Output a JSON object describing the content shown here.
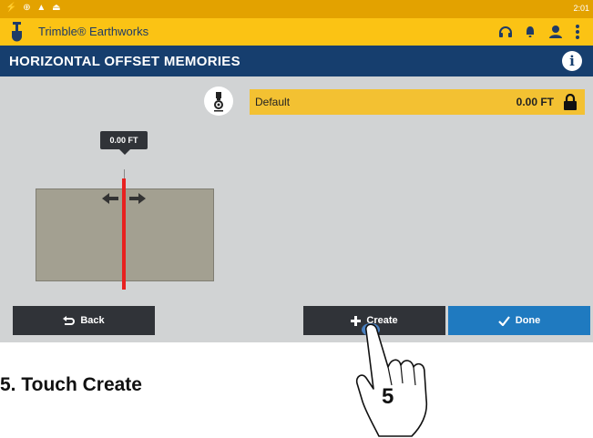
{
  "app": {
    "title": "Trimble® Earthworks",
    "time": "2:01"
  },
  "header": {
    "title": "HORIZONTAL OFFSET MEMORIES"
  },
  "memory": {
    "name": "Default",
    "value": "0.00 FT"
  },
  "plan_view": {
    "offset_label": "0.00 FT"
  },
  "buttons": {
    "back": "Back",
    "create": "Create",
    "done": "Done"
  },
  "instruction": {
    "caption": "5. Touch Create",
    "step": "5"
  },
  "colors": {
    "status_bar": "#e3a200",
    "app_bar": "#fbc314",
    "title_bar": "#163e6e",
    "memory_row": "#f3c132",
    "done_button": "#1f7ac0",
    "dark_button": "#303338",
    "offset_line": "#e8201f"
  }
}
